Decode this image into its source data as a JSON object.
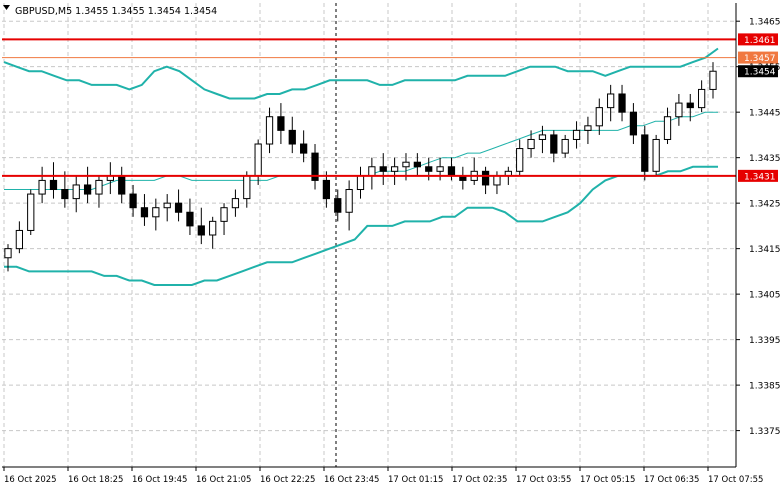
{
  "header": {
    "symbol_line": "GBPUSD,M5  1.3455 1.3455 1.3454 1.3454"
  },
  "colors": {
    "band": "#20b2aa",
    "candle": "#000000",
    "grid": "#c8c8c8",
    "resistance": "#e60000",
    "level": "#f07840",
    "current_price_bg": "#000000"
  },
  "chart_data": {
    "type": "candlestick",
    "title": "GBPUSD,M5  1.3455 1.3455 1.3454 1.3454",
    "ylim": [
      1.3367,
      1.3469
    ],
    "y_ticks": [
      "1.3465",
      "1.3455",
      "1.3445",
      "1.3435",
      "1.3425",
      "1.3415",
      "1.3405",
      "1.3395",
      "1.3385",
      "1.3375"
    ],
    "x_ticks": [
      "16 Oct 2025",
      "16 Oct 18:25",
      "16 Oct 19:45",
      "16 Oct 21:05",
      "16 Oct 22:25",
      "16 Oct 23:45",
      "17 Oct 01:15",
      "17 Oct 02:35",
      "17 Oct 03:55",
      "17 Oct 05:15",
      "17 Oct 06:35",
      "17 Oct 07:55"
    ],
    "grid": true,
    "session_separator": "16 Oct 23:45",
    "price_levels": [
      {
        "label": "1.3461",
        "value": 1.3461,
        "kind": "resistance"
      },
      {
        "label": "1.3457",
        "value": 1.3457,
        "kind": "level"
      },
      {
        "label": "1.3431",
        "value": 1.3431,
        "kind": "resistance"
      }
    ],
    "current_price": "1.3454",
    "upper_band": [
      1.3456,
      1.3455,
      1.3454,
      1.3454,
      1.3453,
      1.3452,
      1.3452,
      1.3451,
      1.3451,
      1.3451,
      1.345,
      1.3451,
      1.3454,
      1.3455,
      1.3454,
      1.3452,
      1.345,
      1.3449,
      1.3448,
      1.3448,
      1.3448,
      1.3449,
      1.3449,
      1.345,
      1.345,
      1.3451,
      1.3452,
      1.3452,
      1.3452,
      1.3452,
      1.3451,
      1.3451,
      1.3452,
      1.3452,
      1.3452,
      1.3452,
      1.3452,
      1.3453,
      1.3453,
      1.3453,
      1.3453,
      1.3454,
      1.3455,
      1.3455,
      1.3455,
      1.3454,
      1.3454,
      1.3454,
      1.3453,
      1.3454,
      1.3455,
      1.3455,
      1.3455,
      1.3455,
      1.3455,
      1.3456,
      1.3457,
      1.3459
    ],
    "middle_band": [
      1.3428,
      1.3428,
      1.3428,
      1.3428,
      1.3428,
      1.3428,
      1.3428,
      1.3428,
      1.3429,
      1.343,
      1.343,
      1.343,
      1.343,
      1.3431,
      1.3431,
      1.343,
      1.343,
      1.343,
      1.343,
      1.343,
      1.343,
      1.343,
      1.3431,
      1.3431,
      1.3431,
      1.3431,
      1.3431,
      1.3431,
      1.3431,
      1.3431,
      1.3432,
      1.3432,
      1.3432,
      1.3433,
      1.3434,
      1.3435,
      1.3435,
      1.3436,
      1.3436,
      1.3437,
      1.3438,
      1.3439,
      1.344,
      1.3441,
      1.3441,
      1.3441,
      1.3441,
      1.3441,
      1.3441,
      1.3441,
      1.3442,
      1.3442,
      1.3443,
      1.3443,
      1.3444,
      1.3444,
      1.3445,
      1.3445
    ],
    "lower_band": [
      1.3411,
      1.3411,
      1.341,
      1.341,
      1.341,
      1.341,
      1.341,
      1.341,
      1.3409,
      1.3409,
      1.3408,
      1.3408,
      1.3407,
      1.3407,
      1.3407,
      1.3407,
      1.3408,
      1.3408,
      1.3409,
      1.341,
      1.3411,
      1.3412,
      1.3412,
      1.3412,
      1.3413,
      1.3414,
      1.3415,
      1.3416,
      1.3417,
      1.342,
      1.342,
      1.342,
      1.3421,
      1.3421,
      1.3421,
      1.3422,
      1.3422,
      1.3424,
      1.3424,
      1.3424,
      1.3423,
      1.3421,
      1.3421,
      1.3421,
      1.3422,
      1.3423,
      1.3425,
      1.3428,
      1.343,
      1.3431,
      1.3431,
      1.3431,
      1.3431,
      1.3432,
      1.3432,
      1.3433,
      1.3433,
      1.3433
    ],
    "candles": [
      [
        1.3413,
        1.3416,
        1.341,
        1.3415
      ],
      [
        1.3415,
        1.3421,
        1.3414,
        1.3419
      ],
      [
        1.3419,
        1.3428,
        1.3418,
        1.3427
      ],
      [
        1.3427,
        1.3433,
        1.3425,
        1.343
      ],
      [
        1.343,
        1.3434,
        1.3426,
        1.3428
      ],
      [
        1.3428,
        1.3432,
        1.3424,
        1.3426
      ],
      [
        1.3426,
        1.3431,
        1.3423,
        1.3429
      ],
      [
        1.3429,
        1.3433,
        1.3425,
        1.3427
      ],
      [
        1.3427,
        1.3431,
        1.3424,
        1.343
      ],
      [
        1.343,
        1.3434,
        1.3427,
        1.3431
      ],
      [
        1.3431,
        1.3433,
        1.3425,
        1.3427
      ],
      [
        1.3427,
        1.3429,
        1.3422,
        1.3424
      ],
      [
        1.3424,
        1.3427,
        1.342,
        1.3422
      ],
      [
        1.3422,
        1.3426,
        1.3419,
        1.3424
      ],
      [
        1.3424,
        1.3427,
        1.3421,
        1.3425
      ],
      [
        1.3425,
        1.3428,
        1.3421,
        1.3423
      ],
      [
        1.3423,
        1.3426,
        1.3418,
        1.342
      ],
      [
        1.342,
        1.3424,
        1.3416,
        1.3418
      ],
      [
        1.3418,
        1.3422,
        1.3415,
        1.3421
      ],
      [
        1.3421,
        1.3425,
        1.3418,
        1.3424
      ],
      [
        1.3424,
        1.3428,
        1.3422,
        1.3426
      ],
      [
        1.3426,
        1.3432,
        1.3424,
        1.3431
      ],
      [
        1.3431,
        1.3439,
        1.3429,
        1.3438
      ],
      [
        1.3438,
        1.3446,
        1.3436,
        1.3444
      ],
      [
        1.3444,
        1.3447,
        1.3438,
        1.3441
      ],
      [
        1.3441,
        1.3444,
        1.3436,
        1.3438
      ],
      [
        1.3438,
        1.3441,
        1.3434,
        1.3436
      ],
      [
        1.3436,
        1.3438,
        1.3428,
        1.343
      ],
      [
        1.343,
        1.3432,
        1.3424,
        1.3426
      ],
      [
        1.3426,
        1.3428,
        1.3421,
        1.3423
      ],
      [
        1.3423,
        1.343,
        1.3419,
        1.3428
      ],
      [
        1.3428,
        1.3433,
        1.3426,
        1.3431
      ],
      [
        1.3431,
        1.3435,
        1.3428,
        1.3433
      ],
      [
        1.3433,
        1.3436,
        1.3429,
        1.3432
      ],
      [
        1.3432,
        1.3435,
        1.3429,
        1.3433
      ],
      [
        1.3433,
        1.3436,
        1.343,
        1.3434
      ],
      [
        1.3434,
        1.3436,
        1.3431,
        1.3433
      ],
      [
        1.3433,
        1.3435,
        1.343,
        1.3432
      ],
      [
        1.3432,
        1.3435,
        1.343,
        1.3433
      ],
      [
        1.3433,
        1.3435,
        1.343,
        1.3431
      ],
      [
        1.3431,
        1.3433,
        1.3428,
        1.343
      ],
      [
        1.343,
        1.3435,
        1.3429,
        1.3432
      ],
      [
        1.3432,
        1.3433,
        1.3427,
        1.3429
      ],
      [
        1.3429,
        1.3432,
        1.3427,
        1.3431
      ],
      [
        1.3431,
        1.3433,
        1.3429,
        1.3432
      ],
      [
        1.3432,
        1.3439,
        1.3431,
        1.3437
      ],
      [
        1.3437,
        1.3441,
        1.3435,
        1.3439
      ],
      [
        1.3439,
        1.3442,
        1.3436,
        1.344
      ],
      [
        1.344,
        1.3441,
        1.3434,
        1.3436
      ],
      [
        1.3436,
        1.344,
        1.3435,
        1.3439
      ],
      [
        1.3439,
        1.3443,
        1.3437,
        1.3441
      ],
      [
        1.3441,
        1.3444,
        1.3438,
        1.3442
      ],
      [
        1.3442,
        1.3448,
        1.344,
        1.3446
      ],
      [
        1.3446,
        1.3451,
        1.3443,
        1.3449
      ],
      [
        1.3449,
        1.3451,
        1.3443,
        1.3445
      ],
      [
        1.3445,
        1.3447,
        1.3438,
        1.344
      ],
      [
        1.344,
        1.3442,
        1.343,
        1.3432
      ],
      [
        1.3432,
        1.344,
        1.3431,
        1.3439
      ],
      [
        1.3439,
        1.3446,
        1.3438,
        1.3444
      ],
      [
        1.3444,
        1.3449,
        1.3442,
        1.3447
      ],
      [
        1.3447,
        1.3449,
        1.3443,
        1.3446
      ],
      [
        1.3446,
        1.3452,
        1.3445,
        1.345
      ],
      [
        1.345,
        1.3456,
        1.3448,
        1.3454
      ]
    ]
  }
}
